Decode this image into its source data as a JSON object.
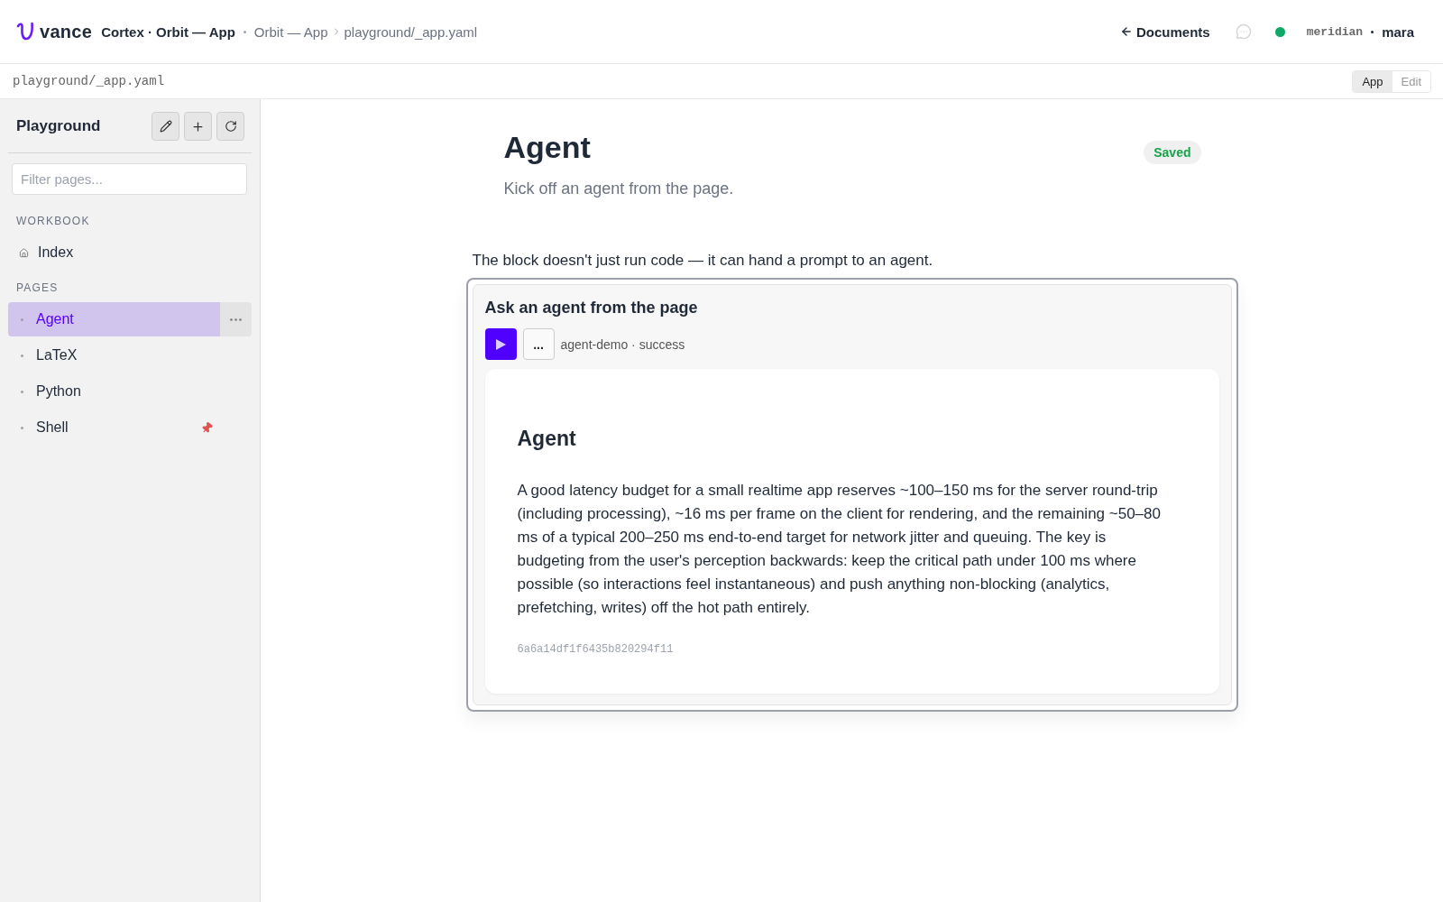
{
  "top_bar": {
    "logo": "vance",
    "workspace": "Cortex · Orbit — App",
    "breadcrumb": [
      "Orbit — App",
      "playground/_app.yaml"
    ],
    "back_link": "Documents",
    "connected": true,
    "user": {
      "org": "meridian",
      "name": "mara"
    }
  },
  "file_bar": {
    "path": "playground/_app.yaml",
    "modes": [
      {
        "label": "App",
        "selected": true
      },
      {
        "label": "Edit",
        "selected": false
      }
    ]
  },
  "sidebar": {
    "title": "Playground",
    "filter": {
      "placeholder": "Filter pages..."
    },
    "sections": [
      {
        "heading": "WORKBOOK",
        "items": [
          {
            "label": "Index",
            "kind": "home",
            "selected": false,
            "pinned": false
          }
        ]
      },
      {
        "heading": "PAGES",
        "items": [
          {
            "label": "Agent",
            "kind": "page",
            "selected": true,
            "pinned": false
          },
          {
            "label": "LaTeX",
            "kind": "page",
            "selected": false,
            "pinned": false
          },
          {
            "label": "Python",
            "kind": "page",
            "selected": false,
            "pinned": false
          },
          {
            "label": "Shell",
            "kind": "page",
            "selected": false,
            "pinned": true
          }
        ]
      }
    ]
  },
  "page": {
    "title": "Agent",
    "subtitle": "Kick off an agent from the page.",
    "save_status": "Saved",
    "intro": "The block doesn't just run code — it can hand a prompt to an agent.",
    "block": {
      "title": "Ask an agent from the page",
      "more_label": "...",
      "status": "agent-demo · success",
      "output": {
        "heading": "Agent",
        "text": "A good latency budget for a small realtime app reserves ~100–150 ms for the server round-trip (including processing), ~16 ms per frame on the client for rendering, and the remaining ~50–80 ms of a typical 200–250 ms end-to-end target for network jitter and queuing. The key is budgeting from the user's perception backwards: keep the critical path under 100 ms where possible (so interactions feel instantaneous) and push anything non-blocking (analytics, prefetching, writes) off the hot path entirely.",
        "hash": "6a6a14df1f6435b820294f11"
      }
    }
  }
}
